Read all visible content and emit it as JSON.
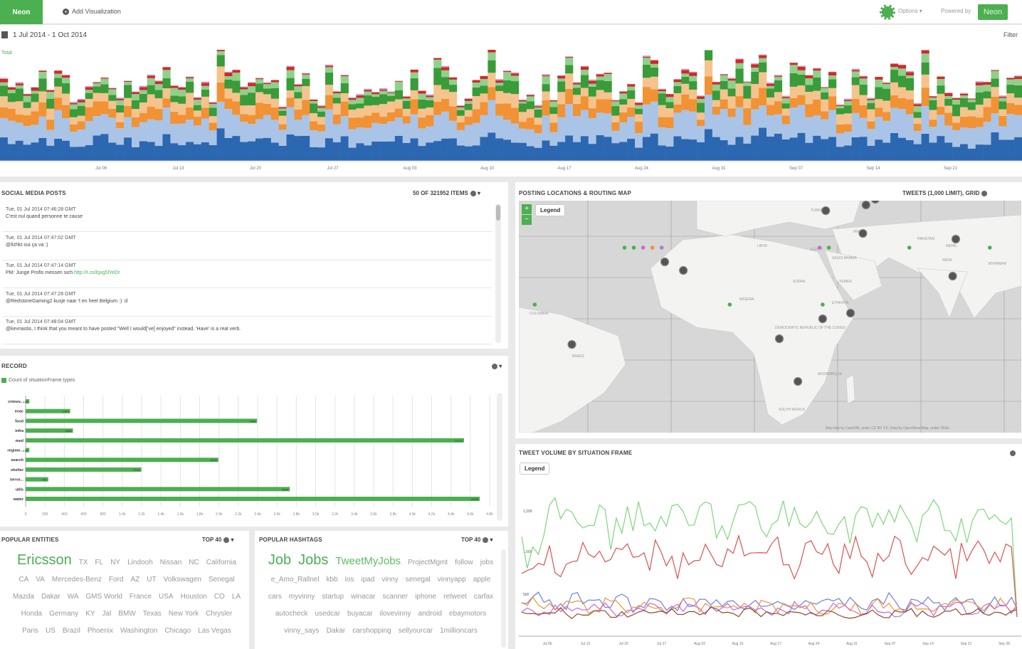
{
  "top_bar": {
    "brand": "Neon",
    "add_visualization": "Add Visualization",
    "options": "Options",
    "powered_by": "Powered by",
    "neon_logo": "Neon"
  },
  "date_range": "1 Jul 2014 - 1 Oct 2014",
  "filter_label": "Filter",
  "timeline": {
    "legend": "Total",
    "tick_labels": [
      "Jul 06",
      "Jul 13",
      "Jul 20",
      "Jul 27",
      "Aug 03",
      "Aug 10",
      "Aug 17",
      "Aug 24",
      "Aug 31",
      "Sep 07",
      "Sep 14",
      "Sep 21"
    ],
    "colors": [
      "#2c67b1",
      "#a9c4e6",
      "#f19235",
      "#f5c38e",
      "#3a9b3a",
      "#8fd18a",
      "#d62728",
      "#c4a1d3"
    ]
  },
  "social_posts": {
    "title": "Social Media Posts",
    "count": "50 of 321952 items",
    "items": [
      {
        "time": "Tue, 01 Jul 2014 07:46:28 GMT",
        "text": "C'est nul quand personne te cause",
        "link": ""
      },
      {
        "time": "Tue, 01 Jul 2014 07:47:02 GMT",
        "text": "@Ilzhkt oui ça va :)",
        "link": ""
      },
      {
        "time": "Tue, 01 Jul 2014 07:47:14 GMT",
        "text": "PM: Junge Profis messen sich ",
        "link": "http://t.co/lqxg5lYeDt"
      },
      {
        "time": "Tue, 01 Jul 2014 07:47:28 GMT",
        "text": "@RedstoneGaming2 kusje naar 't en heel Belgium :) :d",
        "link": ""
      },
      {
        "time": "Tue, 01 Jul 2014 07:48:04 GMT",
        "text": "@kevnastis, I think that you meant to have posted \"Well I would[’ve] enjoyed\" instead. 'Have' is a real verb.",
        "link": ""
      }
    ]
  },
  "record": {
    "title": "Record",
    "legend": "Count of situationFrame.types",
    "bars": [
      {
        "label": "crimev...",
        "value": 120
      },
      {
        "label": "evac",
        "value": 1440
      },
      {
        "label": "food",
        "value": 7480
      },
      {
        "label": "infra",
        "value": 1530
      },
      {
        "label": "med",
        "value": 14170
      },
      {
        "label": "regime...",
        "value": 120
      },
      {
        "label": "search",
        "value": 6230
      },
      {
        "label": "shelter",
        "value": 3740
      },
      {
        "label": "terror...",
        "value": 730
      },
      {
        "label": "utils",
        "value": 8540
      },
      {
        "label": "water",
        "value": 14680
      }
    ],
    "x_ticks": [
      "0",
      "200",
      "400",
      "600",
      "800",
      "1.0k",
      "1.2k",
      "1.4k",
      "1.6k",
      "1.8k",
      "2.0k",
      "2.2k",
      "2.4k",
      "2.6k",
      "2.8k",
      "3.0k",
      "3.2k",
      "3.4k",
      "3.6k",
      "3.8k",
      "4.0k",
      "4.2k",
      "4.4k",
      "4.6k",
      "4.8k"
    ],
    "bar_color": "#4caf50"
  },
  "map": {
    "title": "Posting Locations & Routing Map",
    "right": "Tweets (1,000 limit), Grid",
    "legend": "Legend",
    "attribution": "Map tiles by CartoDB, under CC BY 3.0. Data by OpenStreetMap, under ODbL.",
    "labels": [
      "TURKEY",
      "IRAN",
      "PAKISTAN",
      "NEPAL",
      "INDIA",
      "EGYPT",
      "SAUDI ARABIA",
      "YEMEN",
      "SUDAN",
      "ETHIOPIA",
      "NIGERIA",
      "DEMOCRATIC REPUBLIC OF THE CONGO",
      "MOZAMBIQUE",
      "SOUTH AFRICA",
      "BRAZIL",
      "LIBYA",
      "COLOMBIA",
      "MYANMAR"
    ],
    "cluster_markers": [
      {
        "lon": -5,
        "lat": 37
      },
      {
        "lon": 13,
        "lat": 40
      },
      {
        "lon": 24,
        "lat": 41
      },
      {
        "lon": 33,
        "lat": 39
      },
      {
        "lon": 35,
        "lat": 32
      },
      {
        "lon": 48,
        "lat": 34
      },
      {
        "lon": 51,
        "lat": 36
      },
      {
        "lon": 47,
        "lat": 24
      },
      {
        "lon": 77,
        "lat": 22
      },
      {
        "lon": -17,
        "lat": 14
      },
      {
        "lon": -11,
        "lat": 11
      },
      {
        "lon": 34,
        "lat": -6
      },
      {
        "lon": 20,
        "lat": -13
      },
      {
        "lon": -47,
        "lat": -15
      },
      {
        "lon": 26,
        "lat": -28
      },
      {
        "lon": 76,
        "lat": 9
      },
      {
        "lon": 43,
        "lat": -4
      }
    ],
    "point_markers": [
      {
        "lon": -30,
        "lat": 19,
        "color": "#4caf50"
      },
      {
        "lon": -27,
        "lat": 19,
        "color": "#4caf50"
      },
      {
        "lon": -24,
        "lat": 19,
        "color": "#c86bd1"
      },
      {
        "lon": -21,
        "lat": 19,
        "color": "#f19235"
      },
      {
        "lon": -18,
        "lat": 19,
        "color": "#a97fd1"
      },
      {
        "lon": 36,
        "lat": 19,
        "color": "#4caf50"
      },
      {
        "lon": 33,
        "lat": 19,
        "color": "#c86bd1"
      },
      {
        "lon": 62,
        "lat": 19,
        "color": "#4caf50"
      },
      {
        "lon": 88,
        "lat": 19,
        "color": "#4caf50"
      },
      {
        "lon": -59,
        "lat": -1,
        "color": "#4caf50"
      },
      {
        "lon": 4,
        "lat": -1,
        "color": "#4caf50"
      },
      {
        "lon": 34,
        "lat": -1,
        "color": "#4caf50"
      }
    ]
  },
  "tweet_volume": {
    "title": "Tweet Volume by Situation Frame",
    "legend": "Legend",
    "y_ticks": [
      "1,200",
      "1,000",
      "500"
    ],
    "x_ticks": [
      "Jul 06",
      "Jul 13",
      "Jul 20",
      "Jul 27",
      "Aug 03",
      "Aug 10",
      "Aug 17",
      "Aug 24",
      "Aug 31",
      "Sep 07",
      "Sep 14",
      "Sep 21",
      "Sep 28"
    ],
    "colors": [
      "#7fd67a",
      "#d9534f",
      "#6f7de6",
      "#f19235",
      "#c86bd1",
      "#8b4b2f"
    ]
  },
  "entities": {
    "title": "Popular Entities",
    "top": "Top 40",
    "words": [
      {
        "text": "Ericsson",
        "size": "big"
      },
      {
        "text": "TX"
      },
      {
        "text": "FL"
      },
      {
        "text": "NY"
      },
      {
        "text": "Lindooh"
      },
      {
        "text": "Nissan"
      },
      {
        "text": "NC"
      },
      {
        "text": "California"
      },
      {
        "text": "CA"
      },
      {
        "text": "VA"
      },
      {
        "text": "Mercedes-Benz"
      },
      {
        "text": "Ford"
      },
      {
        "text": "AZ"
      },
      {
        "text": "UT"
      },
      {
        "text": "Volkswagen"
      },
      {
        "text": "Senegal"
      },
      {
        "text": "Mazda"
      },
      {
        "text": "Dakar"
      },
      {
        "text": "WA"
      },
      {
        "text": "GMS World"
      },
      {
        "text": "France"
      },
      {
        "text": "USA"
      },
      {
        "text": "Houston"
      },
      {
        "text": "CO"
      },
      {
        "text": "LA"
      },
      {
        "text": "Honda"
      },
      {
        "text": "Germany"
      },
      {
        "text": "KY"
      },
      {
        "text": "Jal"
      },
      {
        "text": "BMW"
      },
      {
        "text": "Texas"
      },
      {
        "text": "New York"
      },
      {
        "text": "Chrysler"
      },
      {
        "text": "Paris"
      },
      {
        "text": "US"
      },
      {
        "text": "Brazil"
      },
      {
        "text": "Phoenix"
      },
      {
        "text": "Washington"
      },
      {
        "text": "Chicago"
      },
      {
        "text": "Las Vegas"
      }
    ]
  },
  "hashtags": {
    "title": "Popular Hashtags",
    "top": "Top 40",
    "words": [
      {
        "text": "Job",
        "size": "big"
      },
      {
        "text": "Jobs",
        "size": "big"
      },
      {
        "text": "TweetMyJobs",
        "size": "mid"
      },
      {
        "text": "ProjectMgmt"
      },
      {
        "text": "follow"
      },
      {
        "text": "jobs"
      },
      {
        "text": "e_Amo_Rallnel"
      },
      {
        "text": "kbb"
      },
      {
        "text": "ios"
      },
      {
        "text": "ipad"
      },
      {
        "text": "vinny"
      },
      {
        "text": "senegal"
      },
      {
        "text": "vinnyapp"
      },
      {
        "text": "apple"
      },
      {
        "text": "cars"
      },
      {
        "text": "myvinny"
      },
      {
        "text": "startup"
      },
      {
        "text": "winacar"
      },
      {
        "text": "scanner"
      },
      {
        "text": "iphone"
      },
      {
        "text": "retweet"
      },
      {
        "text": "carfax"
      },
      {
        "text": "autocheck"
      },
      {
        "text": "usedcar"
      },
      {
        "text": "buyacar"
      },
      {
        "text": "ilovevinny"
      },
      {
        "text": "android"
      },
      {
        "text": "ebaymotors"
      },
      {
        "text": "vinny_says"
      },
      {
        "text": "Dakar"
      },
      {
        "text": "carshopping"
      },
      {
        "text": "sellyourcar"
      },
      {
        "text": "1millioncars"
      }
    ]
  }
}
